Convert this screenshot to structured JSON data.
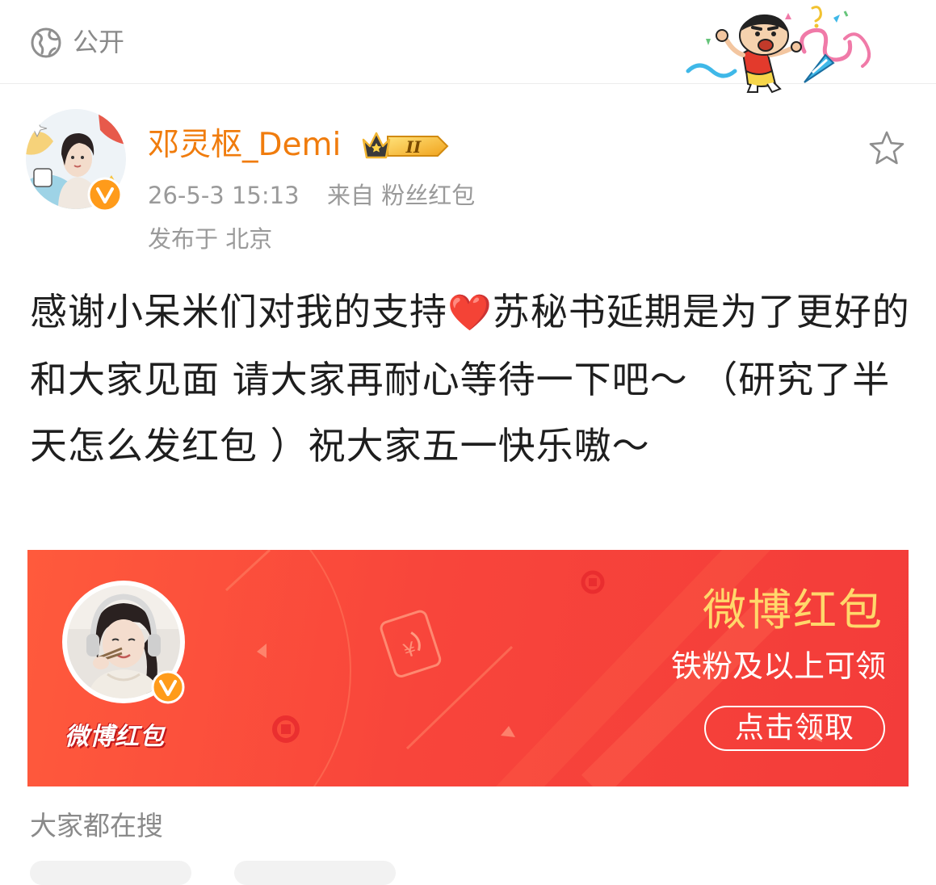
{
  "visibility": {
    "label": "公开",
    "icon": "globe-icon"
  },
  "author": {
    "name": "邓灵枢_Demi",
    "badge_level": "II",
    "verified": true
  },
  "meta": {
    "time": "26-5-3 15:13",
    "source": "来自 粉丝红包",
    "location": "发布于 北京"
  },
  "post": {
    "text_before_heart": "感谢小呆米们对我的支持",
    "heart": "❤️",
    "text_after_heart": "苏秘书延期是为了更好的和大家见面 请大家再耐心等待一下吧～ （研究了半天怎么发红包 ）祝大家五一快乐嗷～"
  },
  "red_packet": {
    "title": "微博红包",
    "subtitle": "铁粉及以上可领",
    "button": "点击领取",
    "logo_text": "微博红包",
    "colors": {
      "background": "#f8453b",
      "title": "#ffd86b"
    }
  },
  "footer": {
    "search_header": "大家都在搜"
  },
  "colors": {
    "author_name": "#f07c0d",
    "meta": "#9a9a9a",
    "text": "#1e1e1e"
  }
}
